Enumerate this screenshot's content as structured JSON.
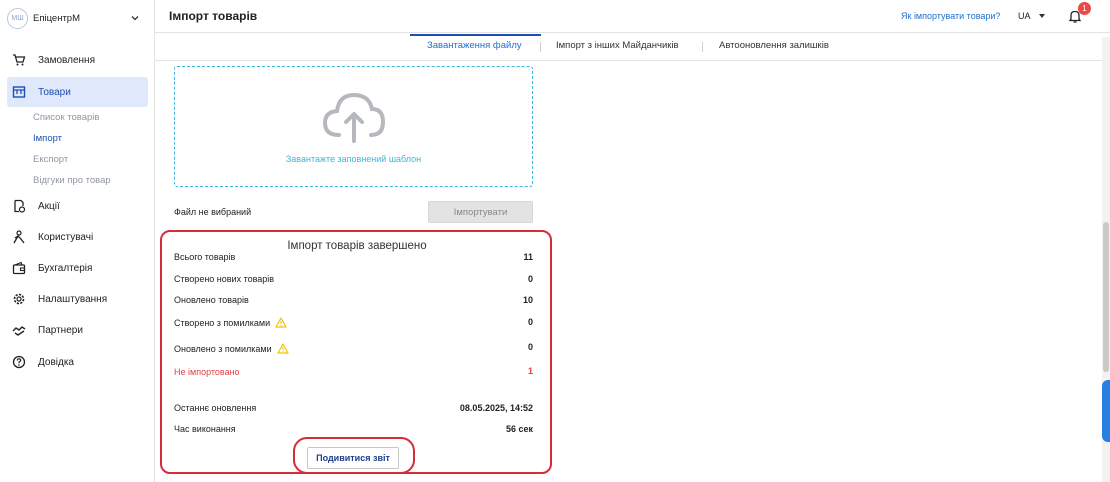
{
  "sidebar": {
    "shop_logo": "МШ",
    "shop_name": "ЕпіцентрМ",
    "items": [
      {
        "label": "Замовлення",
        "icon": "cart-icon"
      },
      {
        "label": "Товари",
        "icon": "box-icon"
      },
      {
        "label": "Акції",
        "icon": "promo-icon"
      },
      {
        "label": "Користувачі",
        "icon": "users-icon"
      },
      {
        "label": "Бухгалтерія",
        "icon": "wallet-icon"
      },
      {
        "label": "Налаштування",
        "icon": "gear-icon"
      },
      {
        "label": "Партнери",
        "icon": "handshake-icon"
      },
      {
        "label": "Довідка",
        "icon": "help-icon"
      }
    ],
    "subitems": [
      "Список товарів",
      "Імпорт",
      "Експорт",
      "Відгуки про товар"
    ],
    "active_item": "Товари",
    "active_subitem": "Імпорт"
  },
  "header": {
    "title": "Імпорт товарів",
    "help_link": "Як імпортувати товари?",
    "language": "UA",
    "notifications_count": "1"
  },
  "tabs": [
    {
      "label": "Завантаження файлу",
      "active": true
    },
    {
      "label": "Імпорт з інших Майданчиків",
      "active": false
    },
    {
      "label": "Автооновлення залишків",
      "active": false
    }
  ],
  "upload": {
    "drop_text": "Завантажте заповнений шаблон",
    "file_status": "Файл не вибраний",
    "import_button": "Імпортувати"
  },
  "result": {
    "title": "Імпорт товарів завершено",
    "rows": [
      {
        "label": "Всього товарів",
        "value": "11"
      },
      {
        "label": "Створено нових товарів",
        "value": "0"
      },
      {
        "label": "Оновлено товарів",
        "value": "10"
      },
      {
        "label": "Створено з помилками",
        "value": "0"
      },
      {
        "label": "Оновлено з помилками",
        "value": "0"
      },
      {
        "label": "Не імпортовано",
        "value": "1"
      },
      {
        "label": "Останнє оновлення",
        "value": "08.05.2025, 14:52"
      },
      {
        "label": "Час виконання",
        "value": "56 сек"
      }
    ],
    "report_button": "Подивитися звіт"
  },
  "colors": {
    "accent": "#1f4fb3",
    "link": "#1f6fd1",
    "dropzone": "#3ab6e0",
    "error": "#e0424a",
    "highlight": "#d52b3a",
    "warning": "#f5c400"
  }
}
